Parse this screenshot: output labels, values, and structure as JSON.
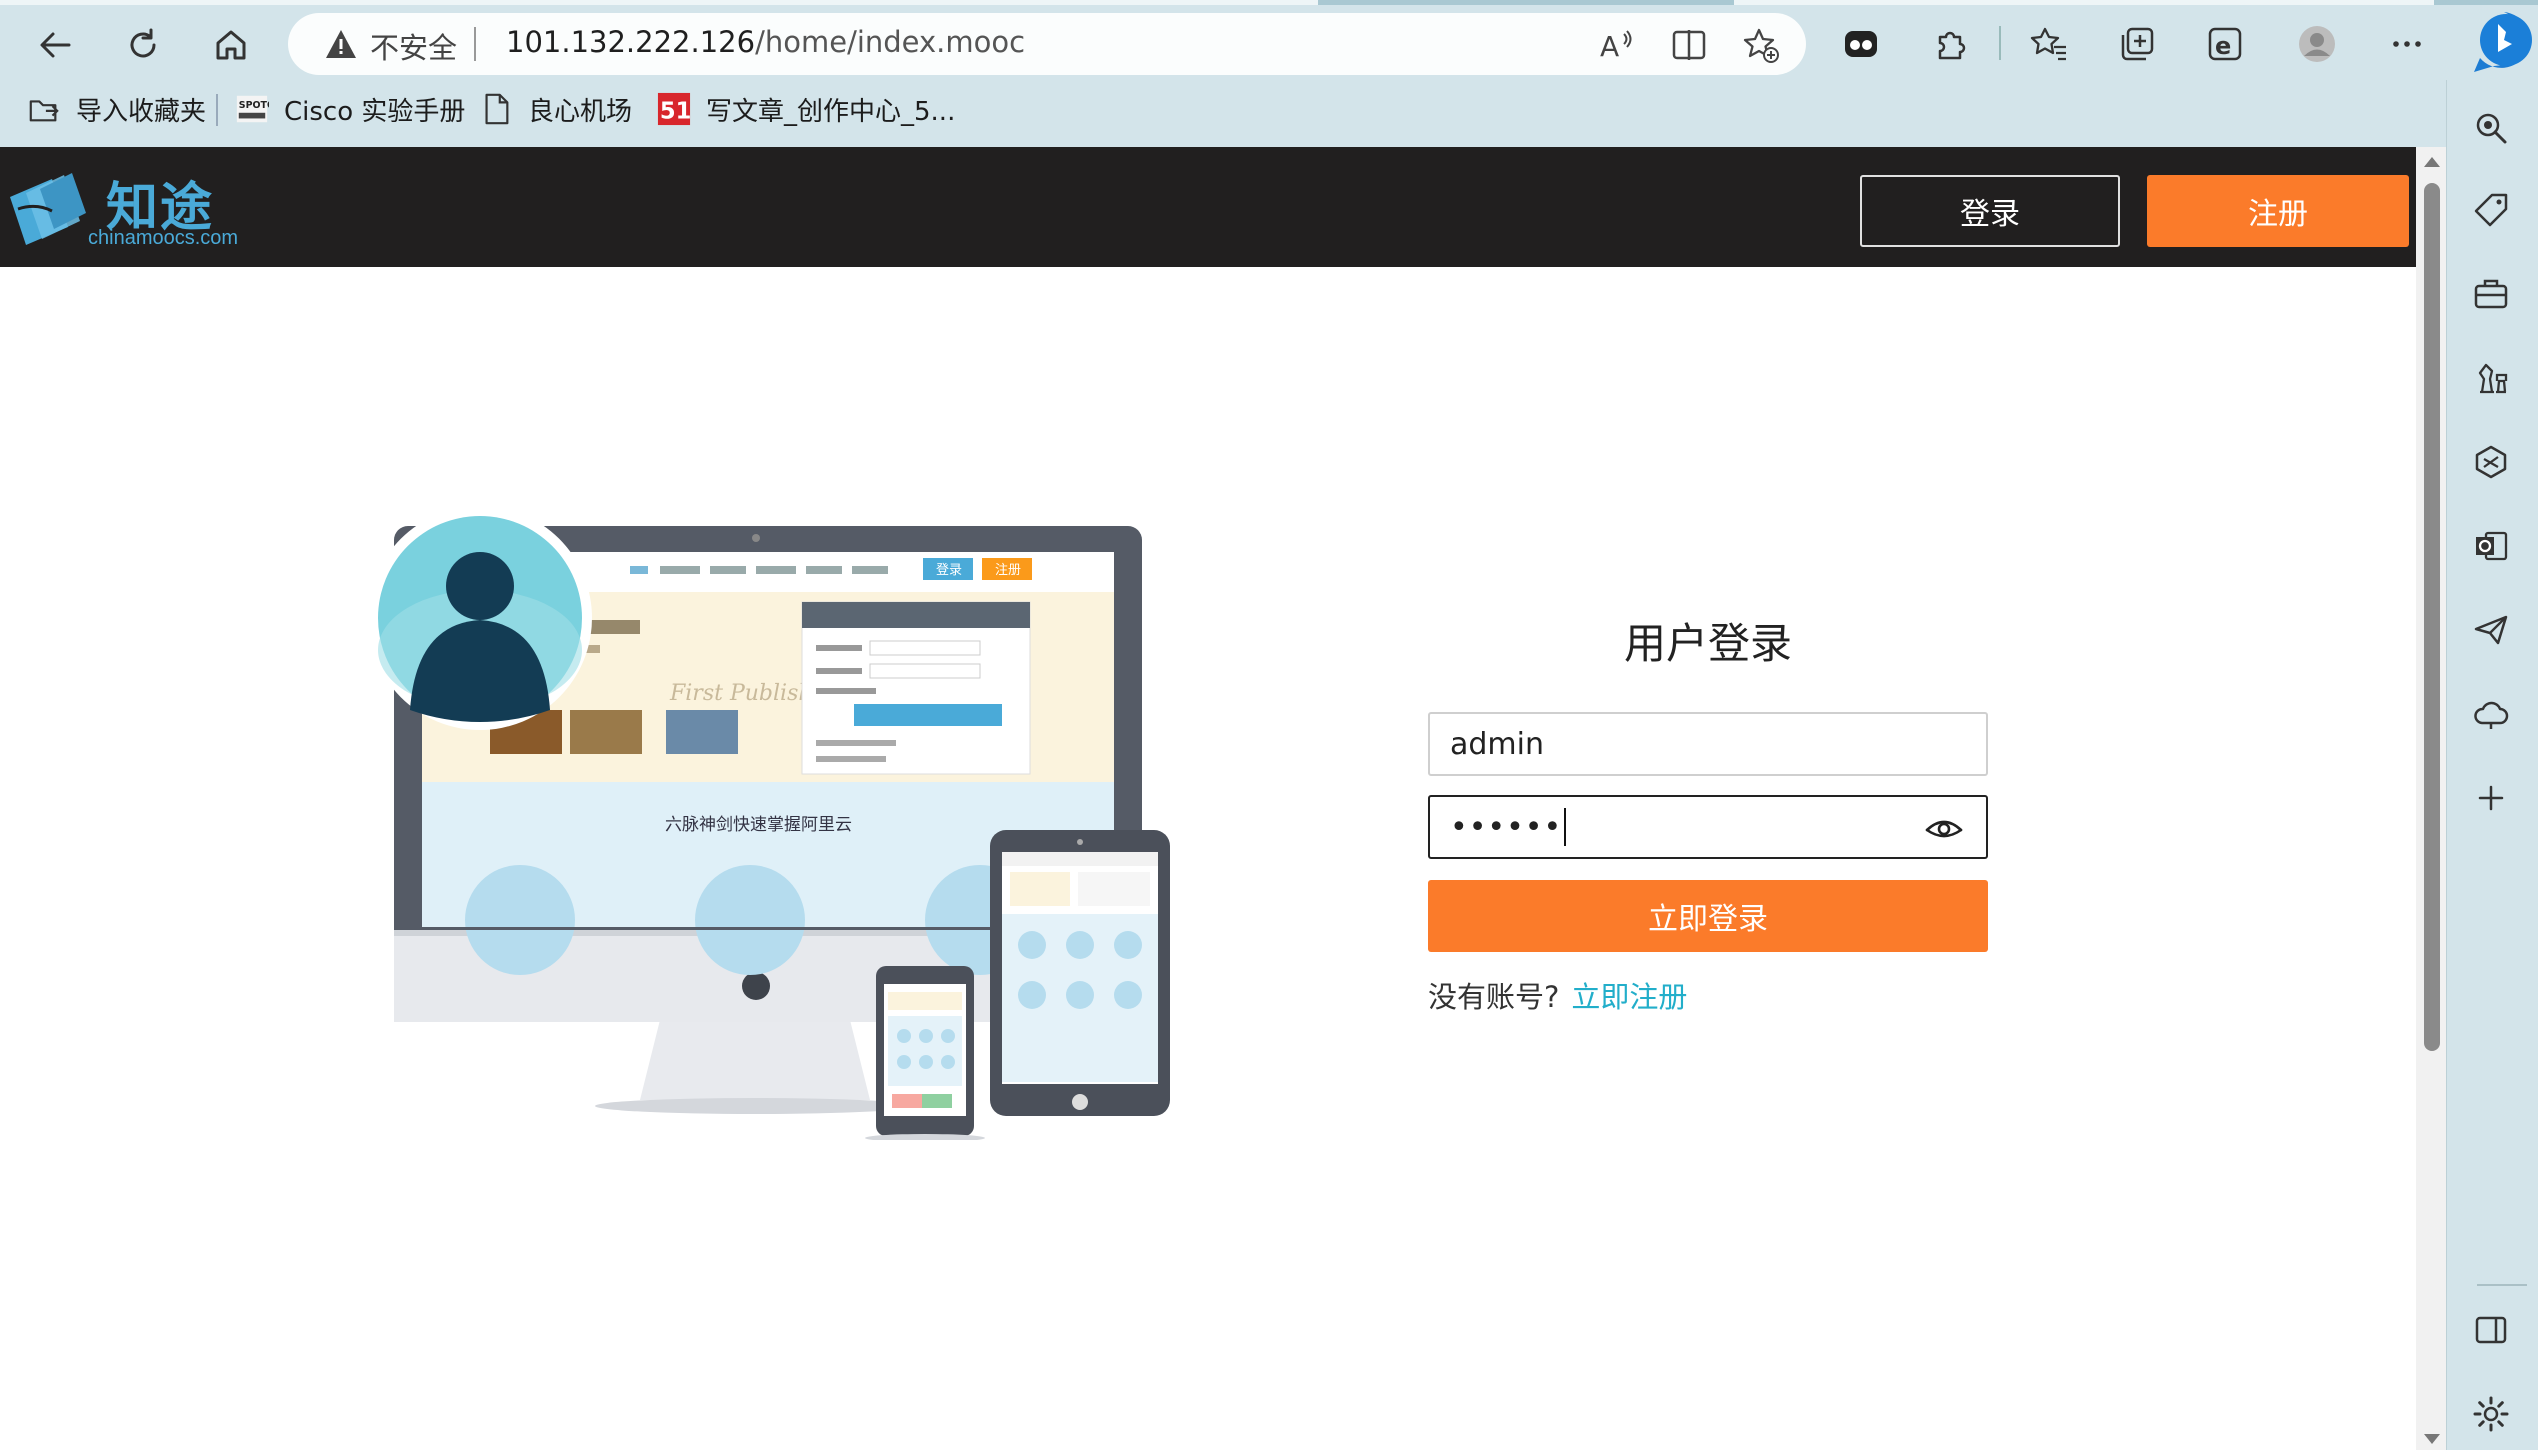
{
  "browser": {
    "address_bar": {
      "security_label": "不安全",
      "url_host": "101.132.222.126",
      "url_path": "/home/index.mooc"
    },
    "icons": {
      "back": "back-arrow-icon",
      "refresh": "refresh-icon",
      "home": "home-icon",
      "read_aloud": "read-aloud-icon",
      "split_screen": "split-screen-icon",
      "add_favorite": "add-favorite-icon",
      "games": "games-icon",
      "extensions": "extensions-icon",
      "favorites": "favorites-icon",
      "collections": "collections-icon",
      "ie_mode": "ie-mode-icon",
      "profile": "profile-icon",
      "more": "more-icon",
      "bing": "bing-icon"
    },
    "bookmarks": [
      {
        "label": "导入收藏夹",
        "icon": "import-icon"
      },
      {
        "label": "Cisco 实验手册",
        "icon": "spoto-icon"
      },
      {
        "label": "良心机场",
        "icon": "page-icon"
      },
      {
        "label": "写文章_创作中心_5...",
        "icon": "51cto-icon"
      }
    ],
    "sidebar_icons": [
      "search-icon",
      "tag-icon",
      "toolbox-icon",
      "chess-icon",
      "office-icon",
      "outlook-icon",
      "send-icon",
      "cloud-icon",
      "add-icon",
      "sidebar-toggle-icon",
      "settings-icon"
    ]
  },
  "site": {
    "logo_text": "知途",
    "logo_sub": "chinamoocs.com",
    "header_login": "登录",
    "header_register": "注册"
  },
  "illustration": {
    "banner_text": "六脉神剑快速掌握阿里云",
    "nav_login": "登录",
    "nav_register": "注册"
  },
  "login": {
    "title": "用户登录",
    "username_value": "admin",
    "password_mask": "••••••",
    "submit_label": "立即登录",
    "no_account_text": "没有账号?",
    "register_link": "立即注册"
  },
  "colors": {
    "accent": "#fb7b2a",
    "header_bg": "#211f1f",
    "link": "#22aeca",
    "logo": "#4aaad8",
    "chrome": "#d3e4ea"
  }
}
